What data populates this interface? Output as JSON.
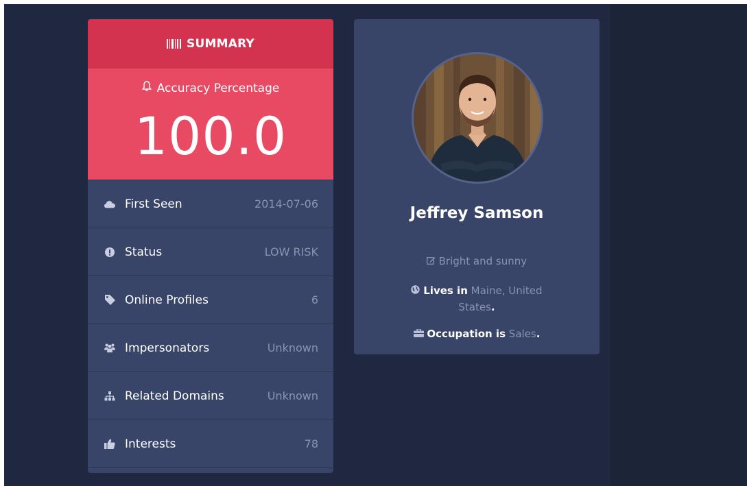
{
  "summary": {
    "title": "SUMMARY",
    "accuracy_label": "Accuracy Percentage",
    "accuracy_value": "100.0",
    "rows": [
      {
        "icon": "cloud-icon",
        "label": "First Seen",
        "value": "2014-07-06"
      },
      {
        "icon": "exclamation-circle-icon",
        "label": "Status",
        "value": "LOW RISK"
      },
      {
        "icon": "tag-icon",
        "label": "Online Profiles",
        "value": "6"
      },
      {
        "icon": "users-icon",
        "label": "Impersonators",
        "value": "Unknown"
      },
      {
        "icon": "sitemap-icon",
        "label": "Related Domains",
        "value": "Unknown"
      },
      {
        "icon": "thumbs-up-icon",
        "label": "Interests",
        "value": "78"
      }
    ]
  },
  "profile": {
    "name": "Jeffrey Samson",
    "tagline": "Bright and sunny",
    "lives_prefix": "Lives in",
    "location": "Maine, United States",
    "lives_suffix": ".",
    "occupation_prefix": "Occupation is",
    "occupation": "Sales",
    "occupation_suffix": "."
  },
  "colors": {
    "background": "#1f2840",
    "panel": "#394469",
    "header_red": "#d3334e",
    "accuracy_red": "#e84a63",
    "muted_text": "#8a93b0"
  }
}
